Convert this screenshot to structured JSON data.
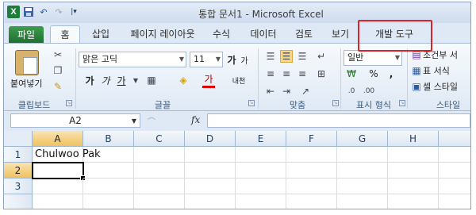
{
  "window": {
    "title": "통합 문서1 - Microsoft Excel"
  },
  "quick_access": {
    "icons": [
      "excel-logo-icon",
      "save-icon",
      "undo-icon",
      "redo-icon",
      "customize-icon"
    ],
    "logo_letter": "X"
  },
  "tabs": [
    {
      "label": "파일"
    },
    {
      "label": "홈"
    },
    {
      "label": "삽입"
    },
    {
      "label": "페이지 레이아웃"
    },
    {
      "label": "수식"
    },
    {
      "label": "데이터"
    },
    {
      "label": "검토"
    },
    {
      "label": "보기"
    },
    {
      "label": "개발 도구"
    }
  ],
  "ribbon": {
    "clipboard": {
      "label": "클립보드",
      "paste_label": "붙여넣기"
    },
    "font": {
      "label": "글꼴",
      "font_name": "맑은 고딕",
      "font_size": "11",
      "grow_label": "가",
      "shrink_label": "가",
      "bold_label": "가",
      "italic_label": "가",
      "underline_label": "가",
      "font_color_label": "가",
      "phonetic_label": "내천"
    },
    "alignment": {
      "label": "맞춤"
    },
    "number": {
      "label": "표시 형식",
      "format": "일반",
      "percent": "%",
      "comma": ","
    },
    "styles": {
      "label": "스타일",
      "conditional": "조건부 서",
      "table_format": "표 서식",
      "cell_styles": "셀 스타일"
    }
  },
  "formula_bar": {
    "name_box": "A2",
    "fx": "fx",
    "content": ""
  },
  "sheet": {
    "columns": [
      "A",
      "B",
      "C",
      "D",
      "E",
      "F",
      "G",
      "H"
    ],
    "rows": [
      "1",
      "2",
      "3"
    ],
    "cells": {
      "A1": "Chulwoo Pak",
      "A2": ""
    },
    "active_cell": "A2"
  },
  "colors": {
    "accent_highlight": "#d9242a",
    "file_tab": "#2d8a3e"
  }
}
